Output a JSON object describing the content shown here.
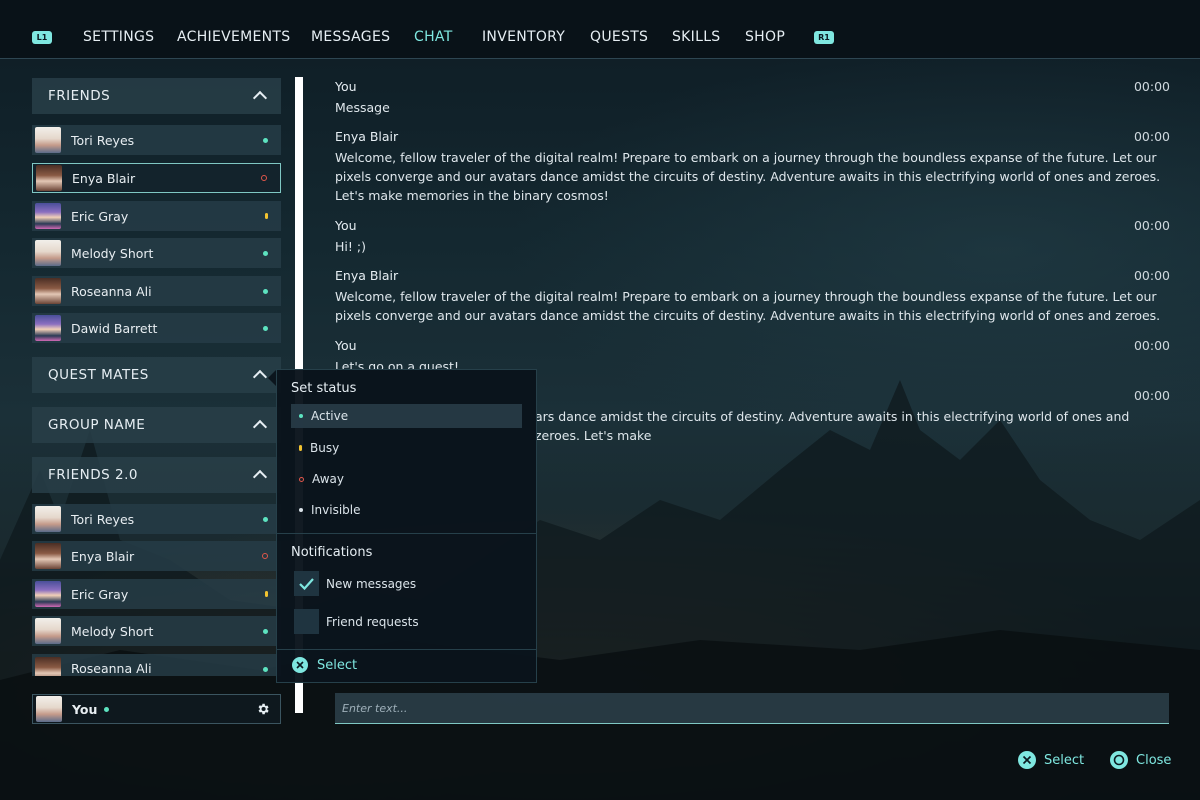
{
  "nav": {
    "left_shoulder": "L1",
    "right_shoulder": "R1",
    "tabs": [
      "SETTINGS",
      "ACHIEVEMENTS",
      "MESSAGES",
      "CHAT",
      "INVENTORY",
      "QUESTS",
      "SKILLS",
      "SHOP"
    ],
    "active_tab": "CHAT"
  },
  "sidebar": {
    "groups": [
      {
        "title": "FRIENDS",
        "expanded": true,
        "members": [
          {
            "name": "Tori Reyes",
            "status": "active"
          },
          {
            "name": "Enya Blair",
            "status": "away"
          },
          {
            "name": "Eric Gray",
            "status": "busy"
          },
          {
            "name": "Melody Short",
            "status": "active"
          },
          {
            "name": "Roseanna Ali",
            "status": "active"
          },
          {
            "name": "Dawid Barrett",
            "status": "active"
          }
        ]
      },
      {
        "title": "QUEST MATES",
        "expanded": false,
        "members": []
      },
      {
        "title": "GROUP NAME",
        "expanded": false,
        "members": []
      },
      {
        "title": "FRIENDS 2.0",
        "expanded": true,
        "members": [
          {
            "name": "Tori Reyes",
            "status": "active"
          },
          {
            "name": "Enya Blair",
            "status": "away"
          },
          {
            "name": "Eric Gray",
            "status": "busy"
          },
          {
            "name": "Melody Short",
            "status": "active"
          },
          {
            "name": "Roseanna Ali",
            "status": "active"
          }
        ]
      }
    ],
    "selected_friend": "Enya Blair",
    "you": {
      "name": "You",
      "status": "active"
    }
  },
  "chat": {
    "messages": [
      {
        "sender": "You",
        "time": "00:00",
        "text": "Message"
      },
      {
        "sender": "Enya Blair",
        "time": "00:00",
        "text": "Welcome, fellow traveler of the digital realm! Prepare to embark on a journey through the boundless expanse of the future. Let our pixels converge and our avatars dance amidst the circuits of destiny. Adventure awaits in this electrifying world of ones and zeroes. Let's make memories in the binary cosmos!"
      },
      {
        "sender": "You",
        "time": "00:00",
        "text": "Hi! ;)"
      },
      {
        "sender": "Enya Blair",
        "time": "00:00",
        "text": "Welcome, fellow traveler of the digital realm! Prepare to embark on a journey through the boundless expanse of the future. Let our pixels converge and our avatars dance amidst the circuits of destiny. Adventure awaits in this electrifying world of ones and zeroes."
      },
      {
        "sender": "You",
        "time": "00:00",
        "text": "Let's go on a quest!"
      },
      {
        "sender": "",
        "time": "00:00",
        "text": "ars dance amidst the circuits of destiny. Adventure awaits in this electrifying world of ones and zeroes. Let's make"
      }
    ],
    "input_placeholder": "Enter text..."
  },
  "status_menu": {
    "title": "Set status",
    "options": [
      {
        "label": "Active",
        "color": "#5de3c0"
      },
      {
        "label": "Busy",
        "color": "#f2c330"
      },
      {
        "label": "Away",
        "color": "#e0564a"
      },
      {
        "label": "Invisible",
        "color": "#dbe4ea"
      }
    ],
    "selected": "Active",
    "notifications_title": "Notifications",
    "notifications": [
      {
        "label": "New messages",
        "checked": true
      },
      {
        "label": "Friend requests",
        "checked": false
      }
    ],
    "select_label": "Select"
  },
  "footer": {
    "select_label": "Select",
    "close_label": "Close"
  },
  "colors": {
    "accent": "#7fe7e0",
    "active": "#5de3c0",
    "busy": "#f2c330",
    "away": "#e0564a"
  }
}
